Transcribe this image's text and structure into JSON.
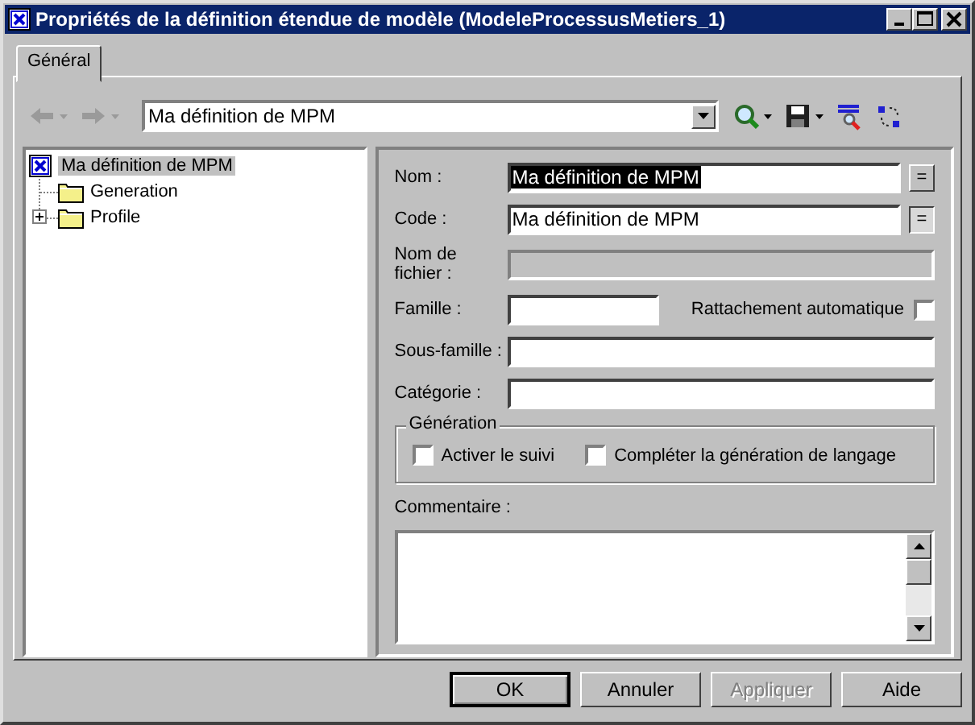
{
  "window": {
    "title": "Propriétés de la définition étendue de modèle (ModeleProcessusMetiers_1)"
  },
  "tabs": [
    {
      "label": "Général",
      "selected": true
    }
  ],
  "toolbar": {
    "nav": [
      {
        "kind": "back",
        "disabled": true
      },
      {
        "kind": "forward",
        "disabled": true
      }
    ],
    "combo": {
      "value": "Ma définition de MPM"
    },
    "tools": [
      {
        "kind": "find"
      },
      {
        "kind": "save"
      },
      {
        "kind": "spell"
      },
      {
        "kind": "replace"
      }
    ]
  },
  "tree": [
    {
      "label": "Ma définition de MPM",
      "selected": true,
      "kind": "model",
      "children": [
        {
          "label": "Generation",
          "selected": false,
          "kind": "folder"
        },
        {
          "label": "Profile",
          "selected": false,
          "kind": "folder",
          "expanded": false
        }
      ]
    }
  ],
  "form": [
    {
      "kind": "text",
      "label": "Nom :",
      "value": "Ma définition de MPM",
      "value_selected": true,
      "button": {
        "label": "=",
        "pressed": false
      }
    },
    {
      "kind": "text",
      "label": "Code :",
      "value": "Ma définition de MPM",
      "value_selected": false,
      "button": {
        "label": "=",
        "pressed": true
      }
    },
    {
      "kind": "text",
      "label": "Nom de fichier :",
      "disabled": true
    },
    {
      "kind": "short_check",
      "label": "Famille :",
      "check_label": "Rattachement automatique",
      "checked": false
    },
    {
      "kind": "text",
      "label": "Sous-famille :"
    },
    {
      "kind": "text",
      "label": "Catégorie :"
    }
  ],
  "group": {
    "title": "Génération",
    "checkboxes": [
      {
        "label": "Activer le suivi",
        "checked": false
      },
      {
        "label": "Compléter la génération de langage",
        "checked": false
      }
    ]
  },
  "comment": {
    "label": "Commentaire :"
  },
  "buttons": [
    {
      "label": "OK",
      "default": true,
      "disabled": false
    },
    {
      "label": "Annuler",
      "default": false,
      "disabled": false
    },
    {
      "label": "Appliquer",
      "default": false,
      "disabled": true
    },
    {
      "label": "Aide",
      "default": false,
      "disabled": false
    }
  ]
}
